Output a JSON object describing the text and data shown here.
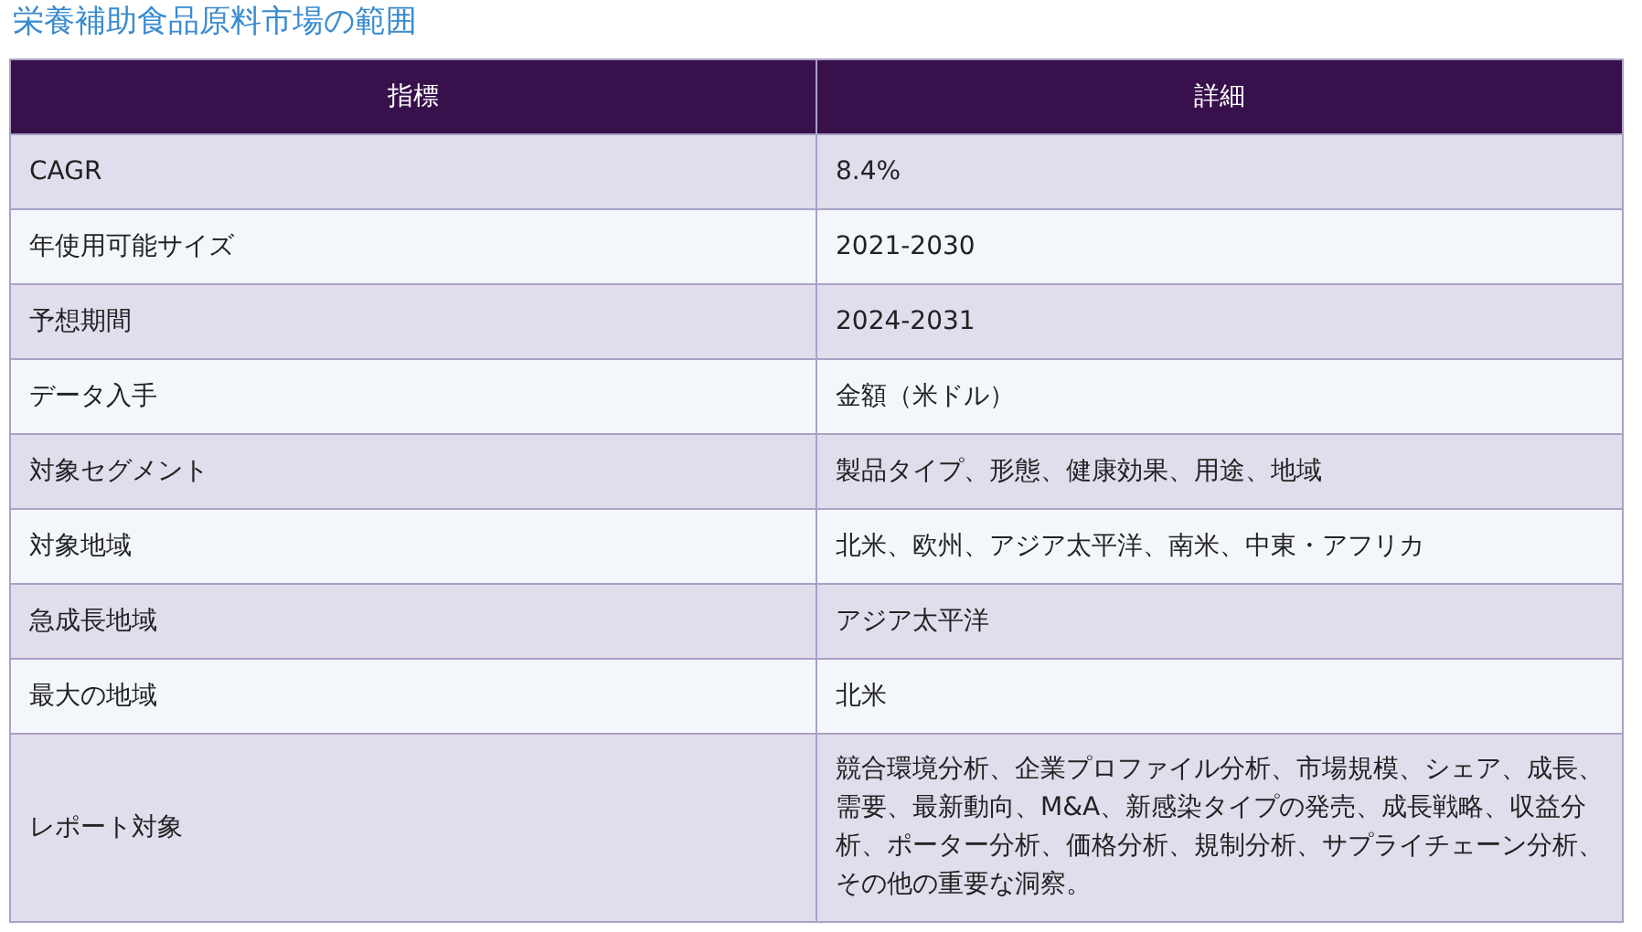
{
  "title": "栄養補助食品原料市場の範囲",
  "table": {
    "columns": [
      "指標",
      "詳細"
    ],
    "rows": [
      [
        "CAGR",
        "8.4%"
      ],
      [
        "年使用可能サイズ",
        "2021-2030"
      ],
      [
        "予想期間",
        "2024-2031"
      ],
      [
        "データ入手",
        "金額（米ドル）"
      ],
      [
        "対象セグメント",
        "製品タイプ、形態、健康効果、用途、地域"
      ],
      [
        "対象地域",
        "北米、欧州、アジア太平洋、南米、中東・アフリカ"
      ],
      [
        "急成長地域",
        "アジア太平洋"
      ],
      [
        "最大の地域",
        "北米"
      ],
      [
        "レポート対象",
        "競合環境分析、企業プロファイル分析、市場規模、シェア、成長、需要、最新動向、M&A、新感染タイプの発売、成長戦略、収益分析、ポーター分析、価格分析、規制分析、サプライチェーン分析、その他の重要な洞察。"
      ]
    ]
  }
}
